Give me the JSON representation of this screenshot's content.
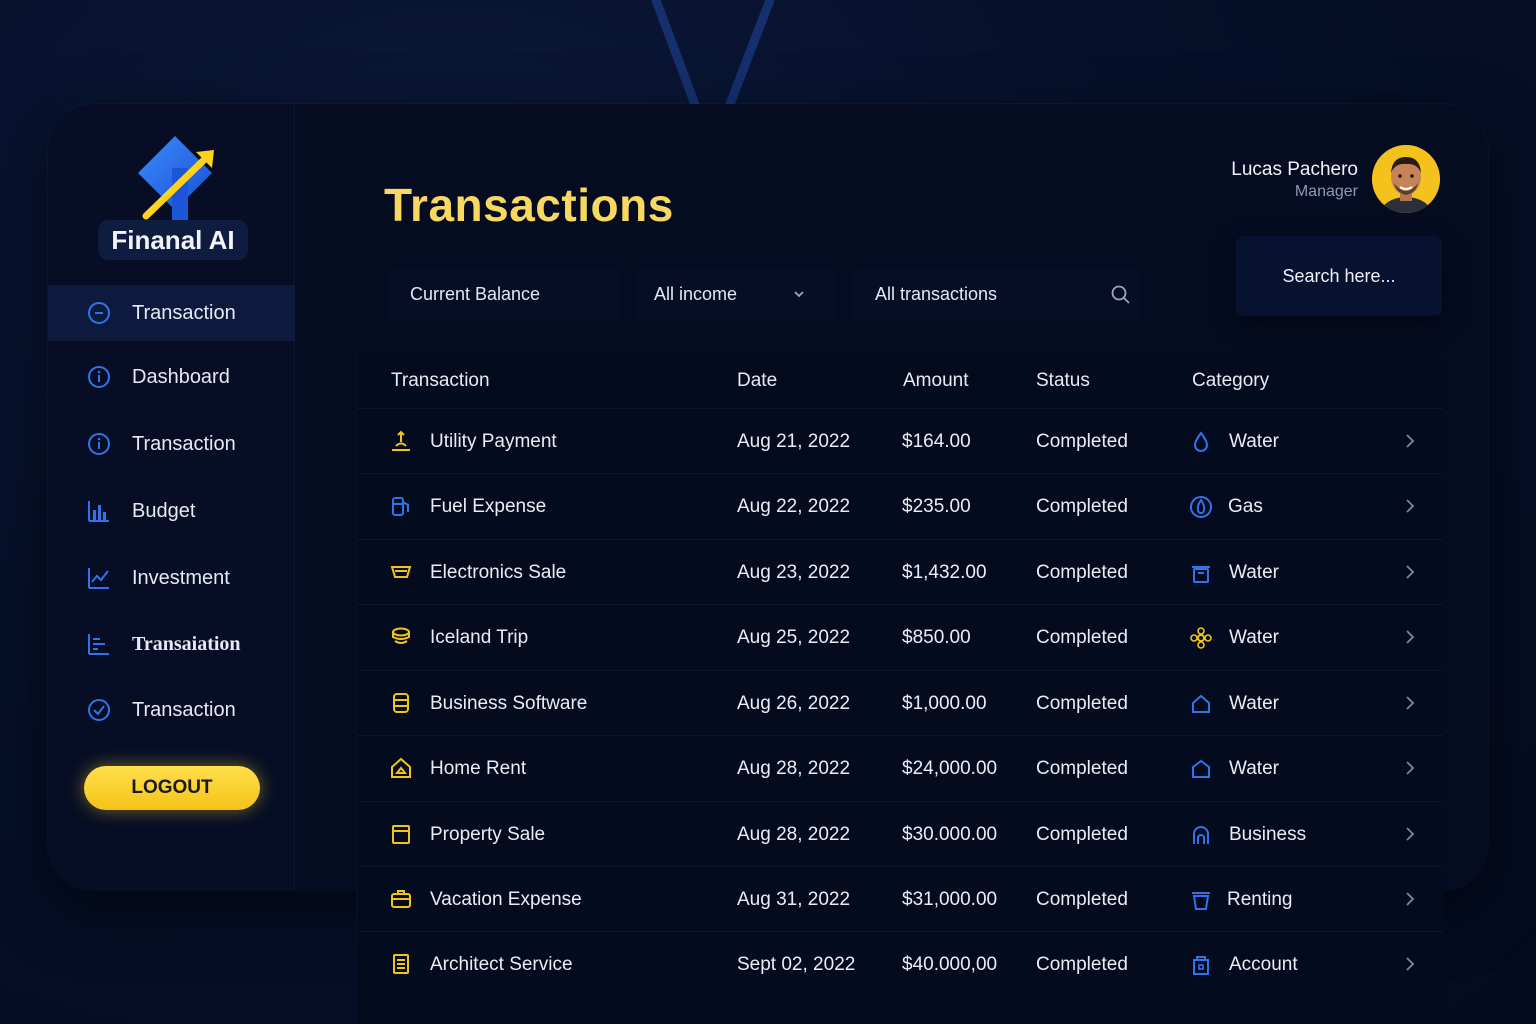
{
  "app": {
    "name": "Finanal AI"
  },
  "page": {
    "title": "Transactions"
  },
  "user": {
    "name": "Lucas Pachero",
    "role": "Manager"
  },
  "search": {
    "label": "Search here..."
  },
  "filters": {
    "balance": "Current Balance",
    "income": "All income",
    "transactions": "All transactions"
  },
  "sidebar": {
    "items": [
      {
        "label": "Transaction",
        "icon": "minus-circle-icon",
        "active": true
      },
      {
        "label": "Dashboard",
        "icon": "info-circle-icon",
        "active": false
      },
      {
        "label": "Transaction",
        "icon": "info-circle-icon",
        "active": false
      },
      {
        "label": "Budget",
        "icon": "bar-chart-icon",
        "active": false
      },
      {
        "label": "Investment",
        "icon": "line-chart-icon",
        "active": false
      },
      {
        "label": "Transaiation",
        "icon": "list-chart-icon",
        "active": false
      },
      {
        "label": "Transaction",
        "icon": "check-circle-icon",
        "active": false
      }
    ],
    "logout": "LOGOUT"
  },
  "table": {
    "headers": [
      "Transaction",
      "Date",
      "Amount",
      "Status",
      "Category"
    ],
    "rows": [
      {
        "name": "Utility Payment",
        "date": "Aug 21, 2022",
        "amount": "$164.00",
        "status": "Completed",
        "category": "Water",
        "icon": "utility-icon",
        "category_icon": "water-drop-icon"
      },
      {
        "name": "Fuel Expense",
        "date": "Aug 22, 2022",
        "amount": "$235.00",
        "status": "Completed",
        "category": "Gas",
        "icon": "fuel-icon",
        "category_icon": "gas-flame-icon"
      },
      {
        "name": "Electronics Sale",
        "date": "Aug 23, 2022",
        "amount": "$1,432.00",
        "status": "Completed",
        "category": "Water",
        "icon": "tray-icon",
        "category_icon": "bin-icon"
      },
      {
        "name": "Iceland Trip",
        "date": "Aug 25, 2022",
        "amount": "$850.00",
        "status": "Completed",
        "category": "Water",
        "icon": "coins-icon",
        "category_icon": "flower-icon"
      },
      {
        "name": "Business Software",
        "date": "Aug 26, 2022",
        "amount": "$1,000.00",
        "status": "Completed",
        "category": "Water",
        "icon": "database-icon",
        "category_icon": "home-outline-icon"
      },
      {
        "name": "Home Rent",
        "date": "Aug 28, 2022",
        "amount": "$24,000.00",
        "status": "Completed",
        "category": "Water",
        "icon": "house-icon",
        "category_icon": "pentagon-icon"
      },
      {
        "name": "Property Sale",
        "date": "Aug 28, 2022",
        "amount": "$30.000.00",
        "status": "Completed",
        "category": "Business",
        "icon": "box-icon",
        "category_icon": "arch-icon"
      },
      {
        "name": "Vacation Expense",
        "date": "Aug 31, 2022",
        "amount": "$31,000.00",
        "status": "Completed",
        "category": "Renting",
        "icon": "suitcase-icon",
        "category_icon": "bucket-icon"
      },
      {
        "name": "Architect Service",
        "date": "Sept 02, 2022",
        "amount": "$40.000,00",
        "status": "Completed",
        "category": "Account",
        "icon": "document-icon",
        "category_icon": "building-icon"
      }
    ]
  },
  "colors": {
    "background": "#040b20",
    "accent_yellow": "#f7d860",
    "icon_blue": "#2f74e8",
    "text": "#e8ecf5"
  }
}
